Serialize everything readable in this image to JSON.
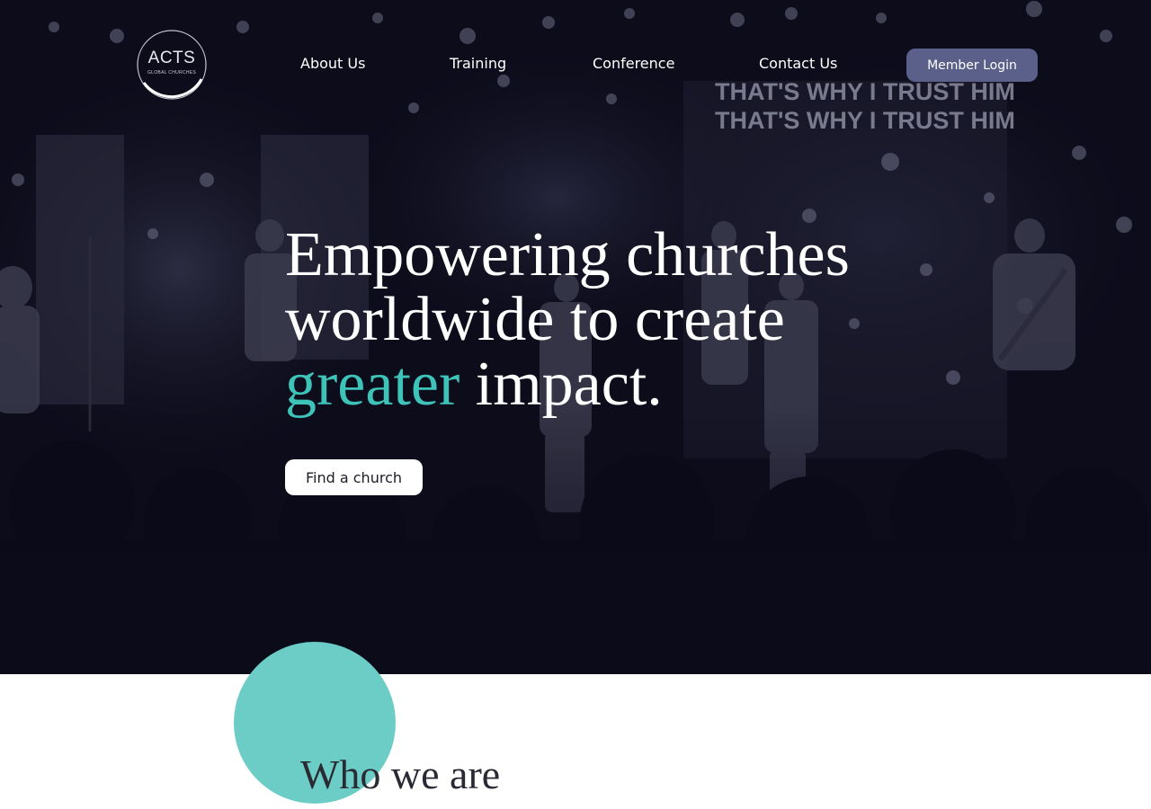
{
  "logo": {
    "name": "ACTS",
    "subtitle": "GLOBAL CHURCHES"
  },
  "nav": {
    "items": [
      {
        "label": "About Us"
      },
      {
        "label": "Training"
      },
      {
        "label": "Conference"
      },
      {
        "label": "Contact Us"
      }
    ],
    "login_label": "Member Login"
  },
  "hero": {
    "title_line1": "Empowering churches",
    "title_line2": "worldwide to create",
    "title_accent": "greater",
    "title_end": " impact.",
    "cta_label": "Find a church",
    "screen_text_1": "THAT'S WHY I TRUST HIM",
    "screen_text_2": "THAT'S WHY I TRUST HIM"
  },
  "section": {
    "title": "Who we are"
  },
  "colors": {
    "hero_bg": "#0b0b1a",
    "accent": "#3dc3b8",
    "login_button": "#5a6089",
    "circle": "#6ccdc6"
  }
}
